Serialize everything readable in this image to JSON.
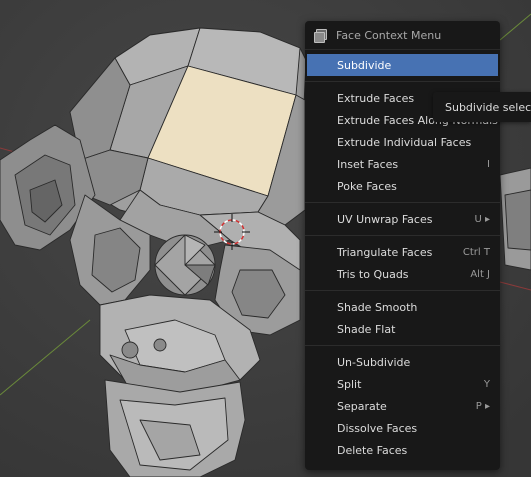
{
  "viewport": {
    "background_color": "#3d3d3d",
    "selected_face_color": "#ede0c2",
    "mesh_color": "#a5a5a5"
  },
  "context_menu": {
    "title": "Face Context Menu",
    "icon": "face-menu-icon",
    "highlight_color": "#4772b3",
    "items": [
      {
        "label": "Subdivide",
        "shortcut": "",
        "active": true
      },
      {
        "separator": true
      },
      {
        "label": "Extrude Faces",
        "shortcut": ""
      },
      {
        "label": "Extrude Faces Along Normals",
        "shortcut": ""
      },
      {
        "label": "Extrude Individual Faces",
        "shortcut": ""
      },
      {
        "label": "Inset Faces",
        "shortcut": "I"
      },
      {
        "label": "Poke Faces",
        "shortcut": ""
      },
      {
        "separator": true
      },
      {
        "label": "UV Unwrap Faces",
        "shortcut": "U ▸"
      },
      {
        "separator": true
      },
      {
        "label": "Triangulate Faces",
        "shortcut": "Ctrl T"
      },
      {
        "label": "Tris to Quads",
        "shortcut": "Alt J"
      },
      {
        "separator": true
      },
      {
        "label": "Shade Smooth",
        "shortcut": ""
      },
      {
        "label": "Shade Flat",
        "shortcut": ""
      },
      {
        "separator": true
      },
      {
        "label": "Un-Subdivide",
        "shortcut": ""
      },
      {
        "label": "Split",
        "shortcut": "Y"
      },
      {
        "label": "Separate",
        "shortcut": "P ▸"
      },
      {
        "label": "Dissolve Faces",
        "shortcut": ""
      },
      {
        "label": "Delete Faces",
        "shortcut": ""
      }
    ]
  },
  "tooltip": {
    "text": "Subdivide selecte"
  }
}
